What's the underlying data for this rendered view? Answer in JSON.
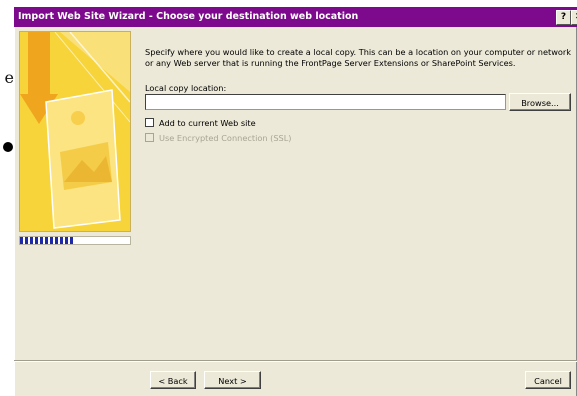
{
  "background": {
    "letter": "e"
  },
  "window": {
    "title": "Import Web Site Wizard - Choose your destination web location",
    "help_glyph": "?",
    "close_glyph": "✕",
    "titlebar_color": "#7d0a8c"
  },
  "wizard": {
    "progress_fraction": 0.48,
    "description": "Specify where you would like to create a local copy.  This can be a location on your computer or network or any Web server that is running the FrontPage Server Extensions or SharePoint Services.",
    "local_copy_label": "Local copy location:",
    "local_copy_value": "",
    "browse_label": "Browse...",
    "add_to_current_label": "Add to current Web site",
    "add_to_current_checked": false,
    "ssl_label": "Use Encrypted Connection (SSL)",
    "ssl_enabled": false
  },
  "footer": {
    "back_label": "< Back",
    "next_label": "Next >",
    "cancel_label": "Cancel"
  },
  "icons": {
    "art": "wizard-art-icon",
    "help": "help-icon",
    "close": "close-icon",
    "checkbox": "checkbox-icon"
  }
}
